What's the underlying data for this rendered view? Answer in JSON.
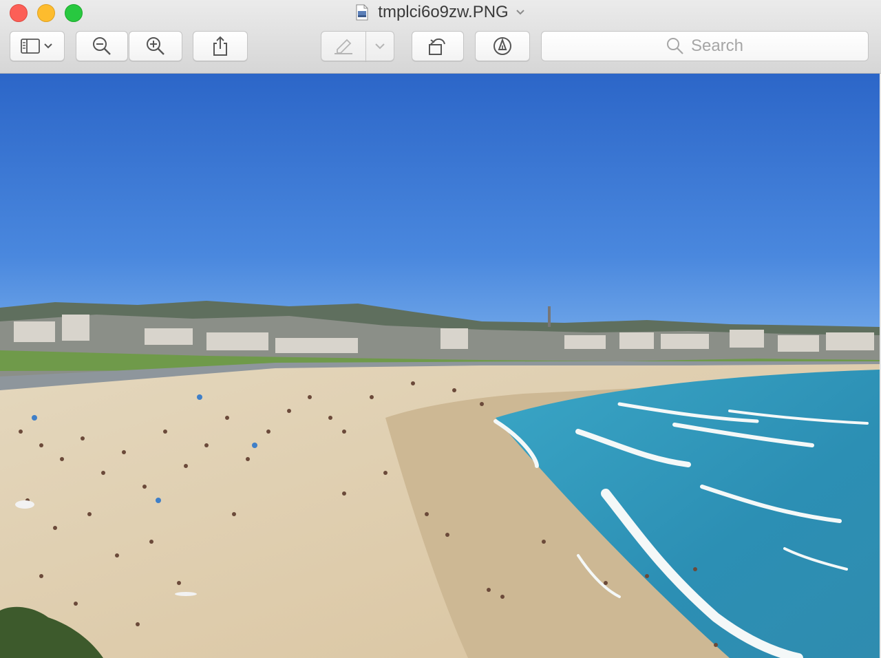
{
  "window": {
    "title": "tmplci6o9zw.PNG",
    "document_icon": "image-file-icon",
    "title_menu_icon": "chevron-down-icon"
  },
  "toolbar": {
    "sidebar_button_icon": "sidebar-icon",
    "zoom_out_icon": "zoom-out-icon",
    "zoom_in_icon": "zoom-in-icon",
    "share_icon": "share-icon",
    "markup_icon": "highlighter-icon",
    "rotate_icon": "rotate-left-icon",
    "annotate_icon": "markup-pen-icon",
    "search_placeholder": "Search"
  },
  "colors": {
    "close": "#fc5f57",
    "minimize": "#fdbc2e",
    "zoom": "#28c840"
  },
  "image": {
    "description_icon": "beach-photo"
  }
}
